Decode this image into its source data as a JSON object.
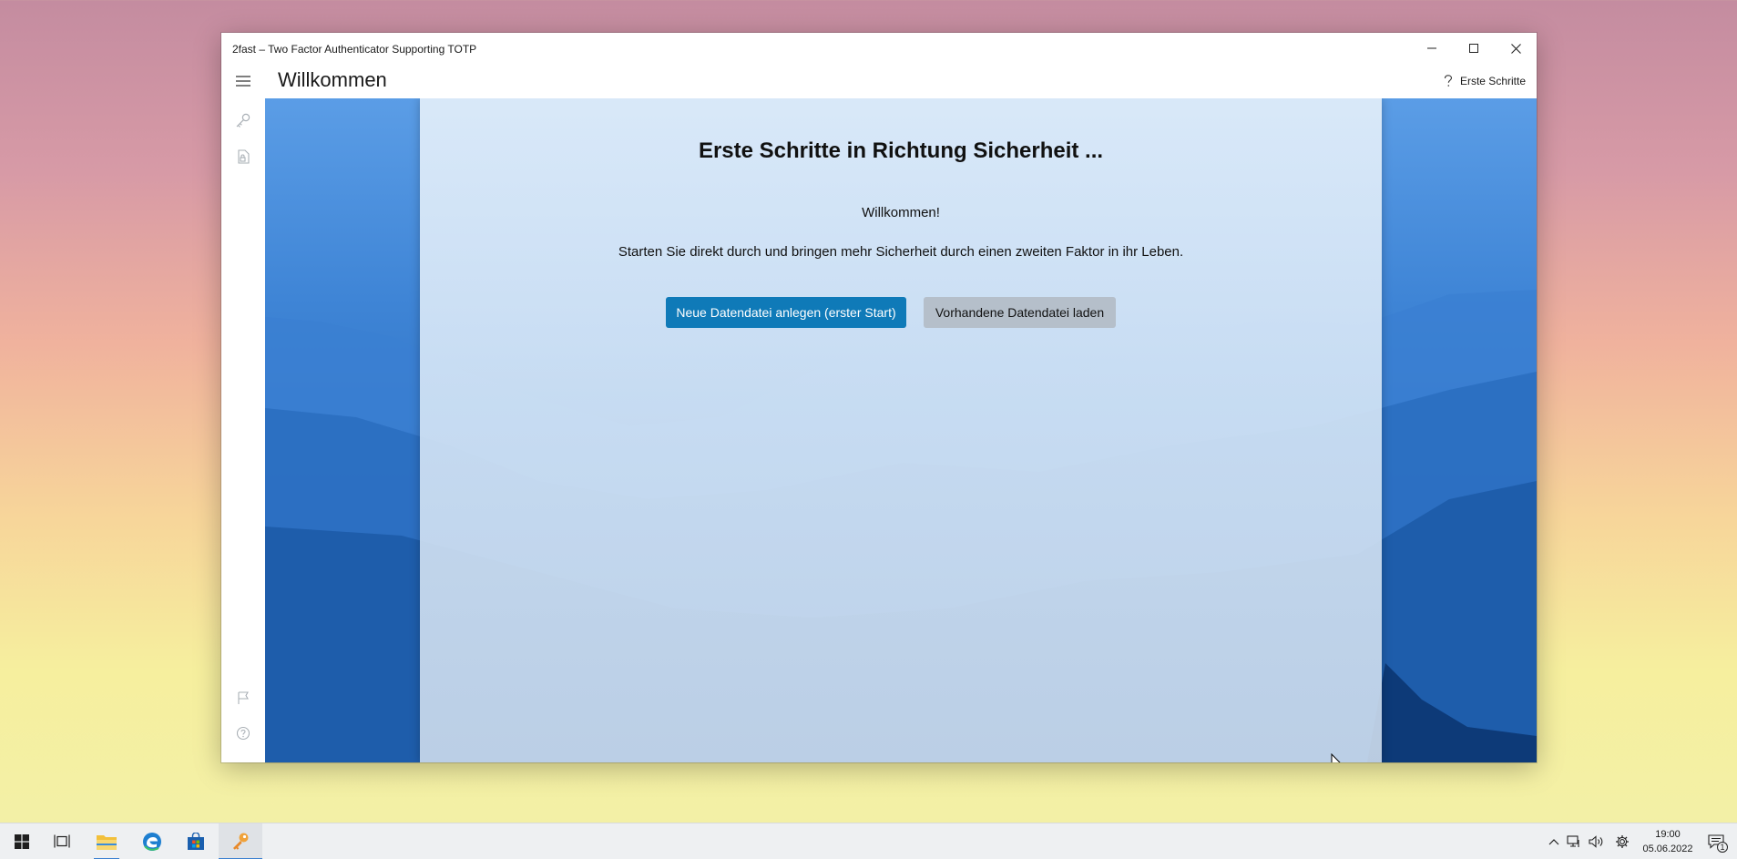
{
  "window": {
    "title": "2fast – Two Factor Authenticator Supporting TOTP",
    "page_title": "Willkommen",
    "help_label": "Erste Schritte"
  },
  "sidebar": {
    "items": [
      {
        "icon": "key-icon"
      },
      {
        "icon": "file-lock-icon"
      },
      {
        "icon": "flag-icon"
      },
      {
        "icon": "help-circle-icon"
      }
    ]
  },
  "main": {
    "heading": "Erste Schritte in Richtung Sicherheit ...",
    "welcome": "Willkommen!",
    "description": "Starten Sie direkt durch und bringen mehr Sicherheit durch einen zweiten Faktor in ihr Leben.",
    "primary_button": "Neue Datendatei anlegen (erster Start)",
    "secondary_button": "Vorhandene Datendatei laden"
  },
  "taskbar": {
    "apps": [
      "start-icon",
      "task-view-icon",
      "file-explorer-icon",
      "edge-icon",
      "store-icon",
      "2fast-key-icon"
    ],
    "time": "19:00",
    "date": "05.06.2022",
    "notification_count": "1"
  },
  "colors": {
    "accent": "#0f7ab8",
    "secondary_button": "#b5bfca"
  }
}
